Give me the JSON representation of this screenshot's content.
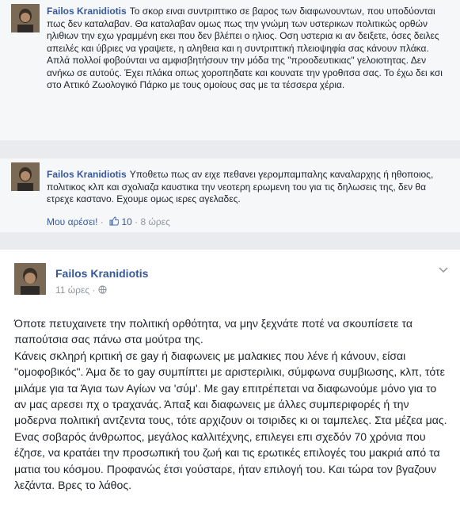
{
  "comments": [
    {
      "author": "Failos Kranidiotis",
      "text": "Το σκορ ειναι συντριπτικο σε βαρος των διαφωνουντων, που υποδύονται πως δεν καταλαβαν. Θα καταλαβαν ομως πως την γνώμη των υστερικων πολιτικώς ορθών ηλιθιων την εχω γραμμένη εκει που δεν βλέπει ο ηλιος. Οση υστερια κι αν δειξετε, όσες δειλες απειλές και ύβριες να γραψετε, η αληθεια και η συντριπτική πλειοψηφία σας κάνουν πλάκα. Απλά πολλοί φοβούνται να αμφισβητήσουν την μόδα της \"προοδευτικιας\" γελοιοτητας. Δεν ανήκω σε αυτούς. Έχει πλάκα οπως χοροπηδατε και κουνατε την γροθιτσα σας. Το έχω δει κσι στο Αττικό Ζωολογικό Πάρκο με τους ομοίους σας με τα τέσσερα χέρια."
    },
    {
      "author": "Failos Kranidiotis",
      "text": "Υποθετω πως αν ειχε πεθανει γερομπαμπαλης καναλαρχης ή ηθοποιος, πολιτικος κλπ και σχολιαζα καυστικα την νεοτερη ερωμενη του για τις δηλωσεις της, δεν θα ετρεχε καστανο. Εχουμε ομως ιερες αγελαδες.",
      "like_label": "Μου αρέσει!",
      "separator": "·",
      "like_count": "10",
      "time": "8 ώρες"
    }
  ],
  "post": {
    "author": "Failos Kranidiotis",
    "time": "11 ώρες",
    "separator": "·",
    "paragraphs": [
      "Όποτε πετυχαινετε την πολιτική ορθότητα, να μην ξεχνάτε ποτέ να σκουπίσετε τα παπούτσια σας πάνω στα μούτρα της.",
      "Κάνεις σκληρή κριτική σε gay ή διαφωνεις με μαλακιες που λένε ή κάνουν, είσαι \"ομοφοβικός\". Άμα δε το gay συμπίπτει με αριστεριλικι, σύμφωνα συμβιωσης, κλπ, τότε μιλάμε για τα Άγια των Αγίων να 'σύμ'. Με gay επιτρέπεται να διαφωνούμε μόνο για το αν μας αρεσει πχ ο τραχανάς. Άπαξ και διαφωνεις με άλλες συμπεριφορές ή την μοδερνα πολιτική αντζεντα τους, τότε αρχιζουν οι τσιριδες κι οι ταμπελες. Στα μέζεα μας.",
      "Ενας σοβαρός άνθρωπος, μεγάλος καλλιτέχνης, επιλεγει επι σχεδόν 70 χρόνια που έζησε, να κρατάει την προσωπική του ζωή και τις ερωτικές επιλογές του μακριά από τα ματια του κόσμου. Προφανώς έτσι γούσταρε, ήταν επιλογή του. Και τώρα τον βγαζουν λεζάντα. Βρες το λάθος."
    ]
  },
  "icons": {
    "thumb": "thumbs-up-icon",
    "globe": "globe-icon",
    "chevron": "chevron-down-icon"
  },
  "colors": {
    "link": "#365899",
    "text": "#1d2129",
    "meta": "#90949c",
    "comment_bg": "#f6f7f9",
    "page_bg": "#e9ebee"
  }
}
